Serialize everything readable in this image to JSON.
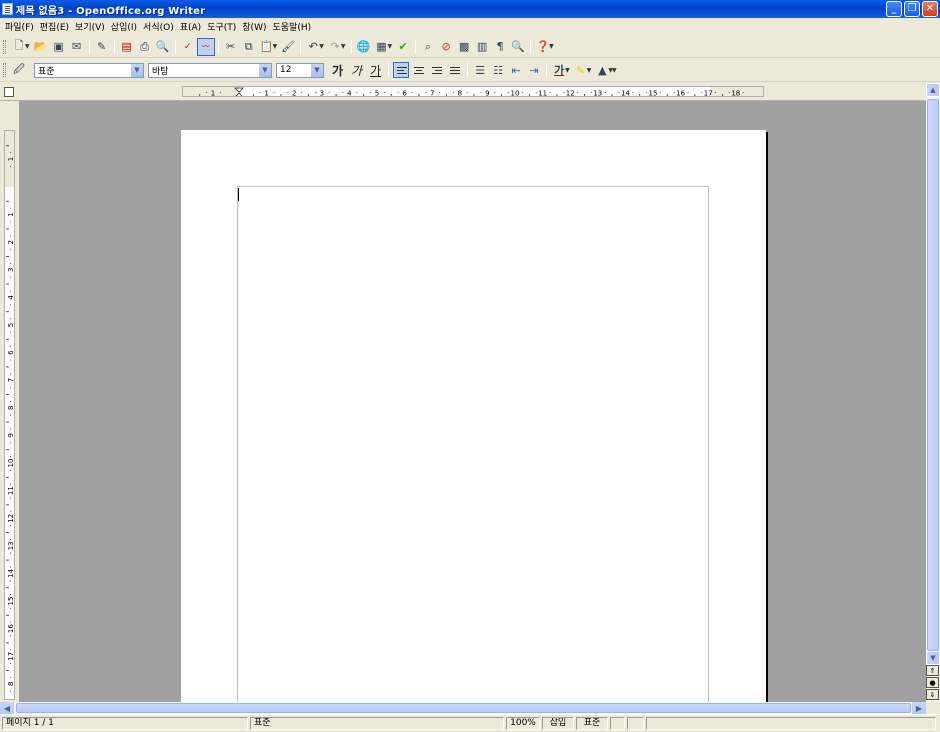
{
  "window": {
    "title": "제목 없음3 - OpenOffice.org Writer"
  },
  "menu": [
    "파일(F)",
    "편집(E)",
    "보기(V)",
    "삽입(I)",
    "서식(O)",
    "표(A)",
    "도구(T)",
    "창(W)",
    "도움말(H)"
  ],
  "toolbar": {
    "icons": [
      "new-icon",
      "open-icon",
      "save-icon",
      "email-icon",
      "edit-file-icon",
      "export-pdf-icon",
      "print-icon",
      "page-preview-icon",
      "spellcheck-icon",
      "autospellcheck-icon",
      "cut-icon",
      "copy-icon",
      "paste-icon",
      "clone-format-icon",
      "undo-icon",
      "redo-icon",
      "hyperlink-icon",
      "table-icon",
      "draw-functions-icon",
      "find-replace-icon",
      "navigator-icon",
      "gallery-icon",
      "data-sources-icon",
      "formatting-marks-icon",
      "zoom-icon",
      "help-icon"
    ]
  },
  "format_toolbar": {
    "style_value": "표준",
    "font_value": "바탕",
    "size_value": "12",
    "bold_label": "가",
    "italic_label": "가",
    "underline_label": "가"
  },
  "ruler": {
    "h_ticks": [
      "1",
      "1",
      "2",
      "3",
      "4",
      "5",
      "6",
      "7",
      "8",
      "9",
      "10",
      "11",
      "12",
      "13",
      "14",
      "15",
      "16",
      "17",
      "18"
    ],
    "v_ticks": [
      "1",
      "1",
      "2",
      "3",
      "4",
      "5",
      "6",
      "7",
      "8",
      "9",
      "10",
      "11",
      "12",
      "13",
      "14",
      "15",
      "16",
      "17",
      "8"
    ]
  },
  "status": {
    "page": "페이지 1 / 1",
    "style": "표준",
    "zoom": "100%",
    "insert_mode": "삽입",
    "selection_mode": "표준"
  },
  "colors": {
    "titlebar": "#0a5ee8",
    "workspace": "#a0a0a0"
  }
}
